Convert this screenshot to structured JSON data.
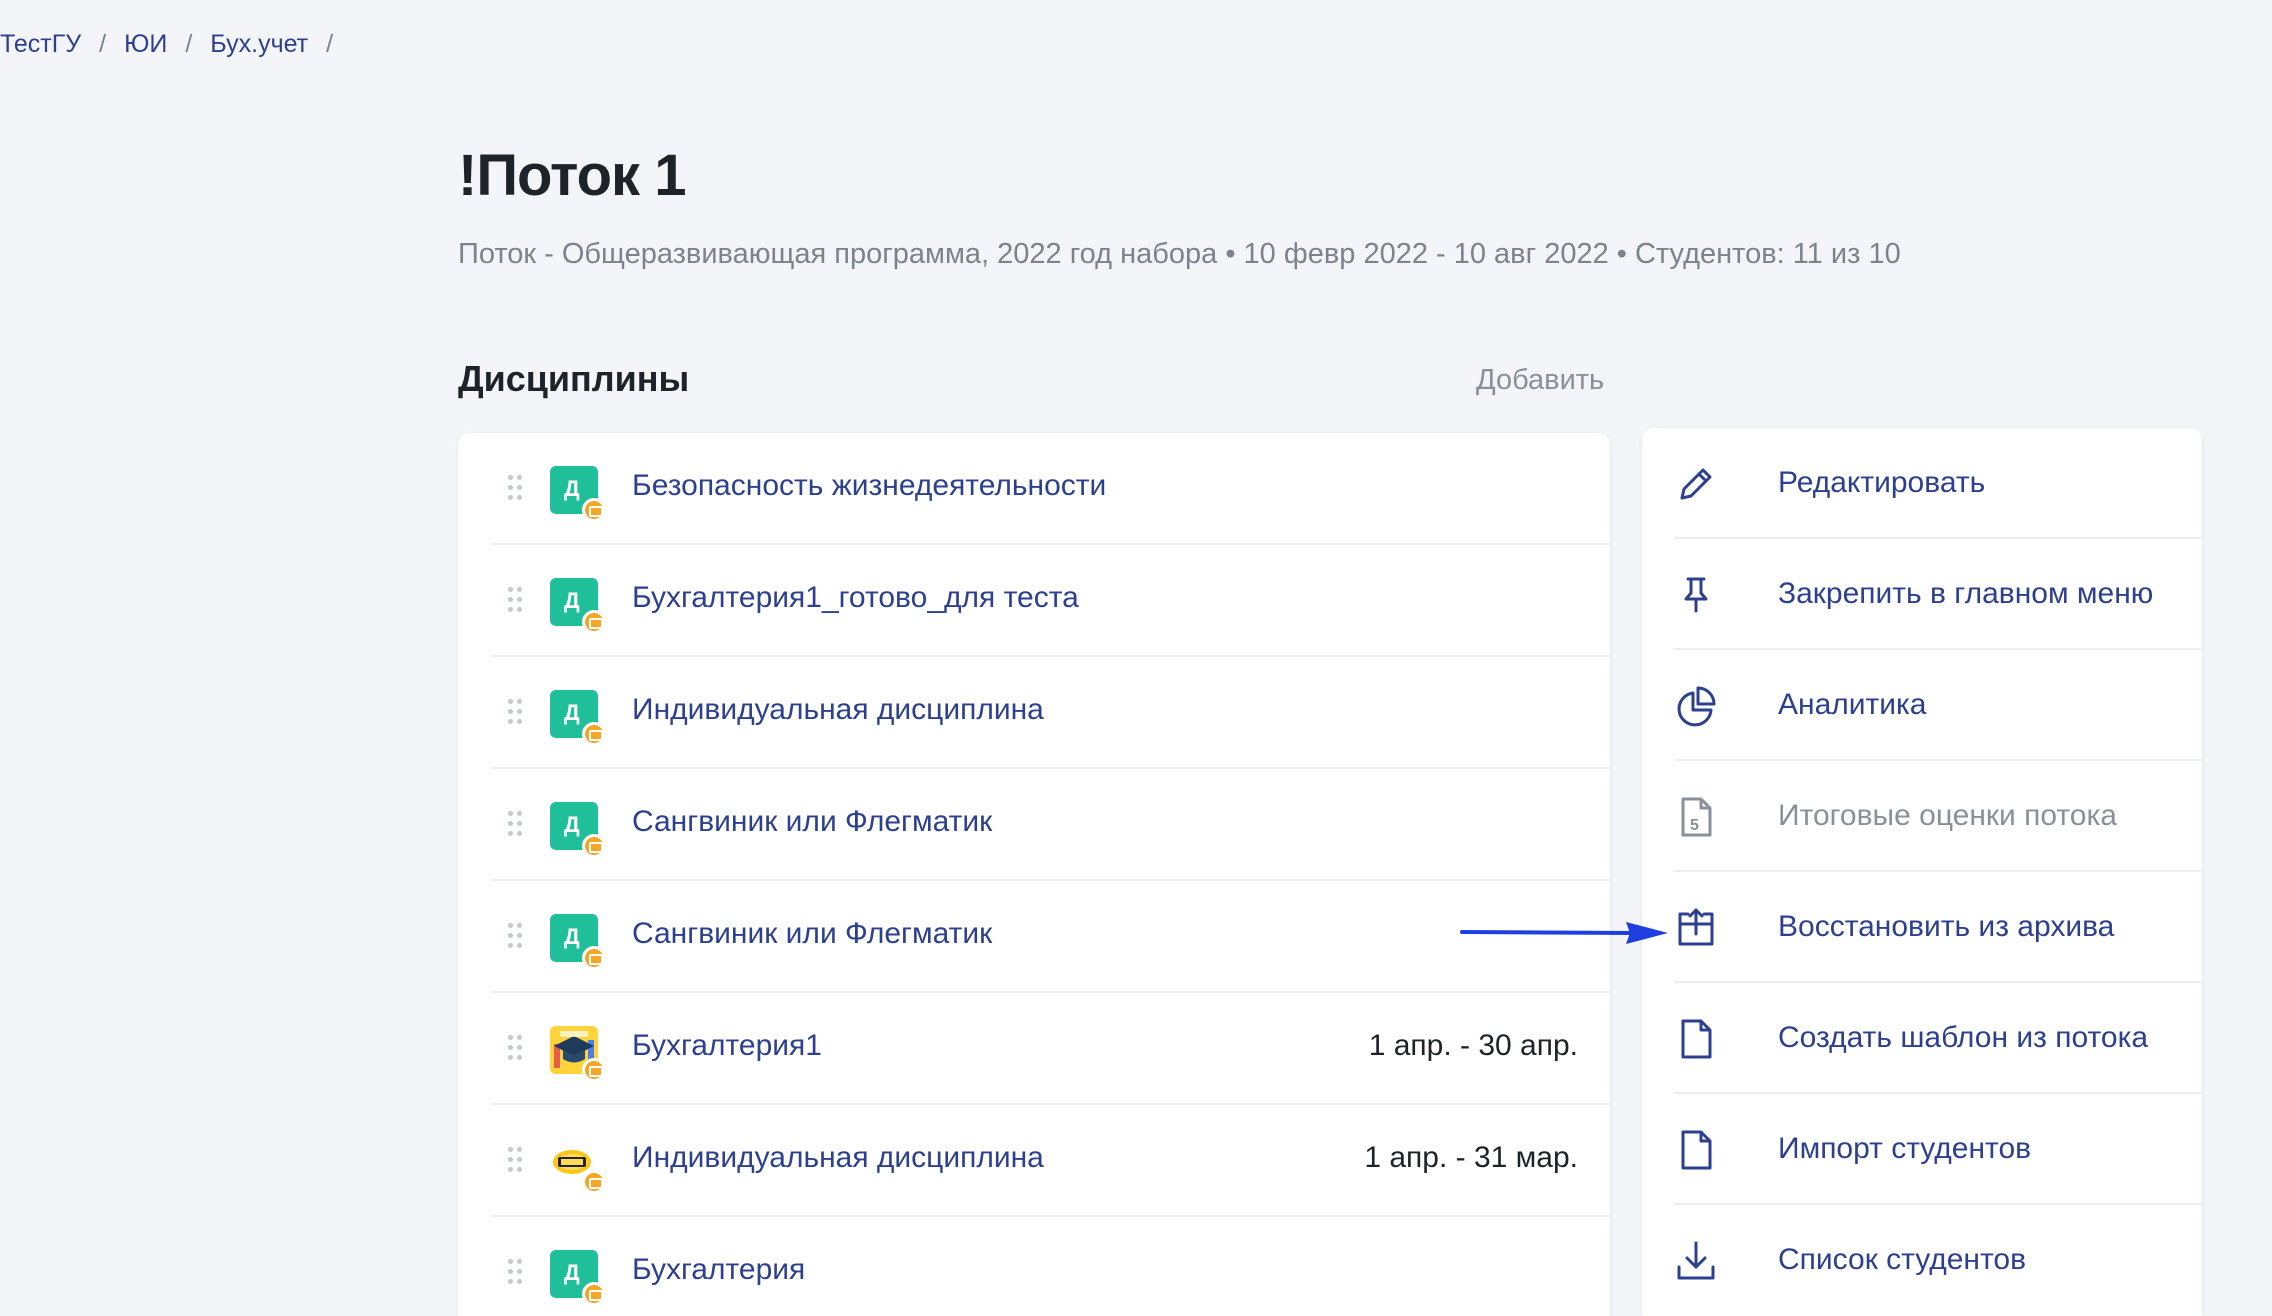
{
  "breadcrumb": [
    "ТестГУ",
    "ЮИ",
    "Бух.учет"
  ],
  "breadcrumb_separator": "/",
  "page": {
    "title": "!Поток 1",
    "subtitle": "Поток - Общеразвивающая программа, 2022 год набора • 10 февр 2022 - 10 авг 2022 • Студентов: 11 из 10"
  },
  "disciplines": {
    "title": "Дисциплины",
    "add_label": "Добавить",
    "items": [
      {
        "icon": "green-letter-icon",
        "letter": "Д",
        "title": "Безопасность жизнедеятельности",
        "date": ""
      },
      {
        "icon": "green-letter-icon",
        "letter": "Д",
        "title": "Бухгалтерия1_готово_для теста",
        "date": ""
      },
      {
        "icon": "green-letter-icon",
        "letter": "Д",
        "title": "Индивидуальная дисциплина",
        "date": ""
      },
      {
        "icon": "green-letter-icon",
        "letter": "Д",
        "title": "Сангвиник или Флегматик",
        "date": ""
      },
      {
        "icon": "green-letter-icon",
        "letter": "Д",
        "title": "Сангвиник или Флегматик",
        "date": ""
      },
      {
        "icon": "graduation-cap-image-icon",
        "letter": "",
        "title": "Бухгалтерия1",
        "date": "1 апр. - 30 апр."
      },
      {
        "icon": "demo-image-icon",
        "letter": "",
        "title": "Индивидуальная дисциплина",
        "date": "1 апр. - 31 мар."
      },
      {
        "icon": "green-letter-icon",
        "letter": "Д",
        "title": "Бухгалтерия",
        "date": ""
      }
    ]
  },
  "actions": [
    {
      "icon": "pencil-icon",
      "label": "Редактировать",
      "disabled": false
    },
    {
      "icon": "pin-icon",
      "label": "Закрепить в главном меню",
      "disabled": false
    },
    {
      "icon": "pie-chart-icon",
      "label": "Аналитика",
      "disabled": false
    },
    {
      "icon": "grade-document-icon",
      "label": "Итоговые оценки потока",
      "disabled": true
    },
    {
      "icon": "archive-restore-icon",
      "label": "Восстановить из архива",
      "disabled": false
    },
    {
      "icon": "document-icon",
      "label": "Создать шаблон из потока",
      "disabled": false
    },
    {
      "icon": "document-icon",
      "label": "Импорт студентов",
      "disabled": false
    },
    {
      "icon": "download-icon",
      "label": "Список студентов",
      "disabled": false
    }
  ],
  "colors": {
    "link": "#2d3f8f",
    "course_green": "#1fbf9a",
    "badge_orange": "#f5a623",
    "annotation_arrow": "#1f3ee0"
  }
}
